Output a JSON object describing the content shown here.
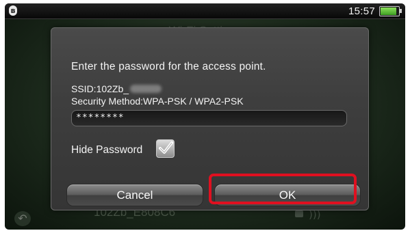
{
  "statusbar": {
    "bluetooth_icon": "bluetooth-icon",
    "time": "15:57",
    "battery_icon": "battery-icon",
    "battery_level": 0.9,
    "battery_color": "#5cc43a"
  },
  "background": {
    "title": "Wi-Fi Settings",
    "network_name": "102Zb_E808C6",
    "back_icon": "back-arrow-icon",
    "lock_icon": "lock-icon",
    "signal_icon": "wifi-signal-icon"
  },
  "dialog": {
    "prompt": "Enter the password for the access point.",
    "ssid_label": "SSID:102Zb_",
    "security": "Security Method:WPA-PSK / WPA2-PSK",
    "password_value": "********",
    "hide_password_label": "Hide Password",
    "hide_password_checked": true,
    "cancel_label": "Cancel",
    "ok_label": "OK",
    "highlight_color": "#e01020"
  }
}
